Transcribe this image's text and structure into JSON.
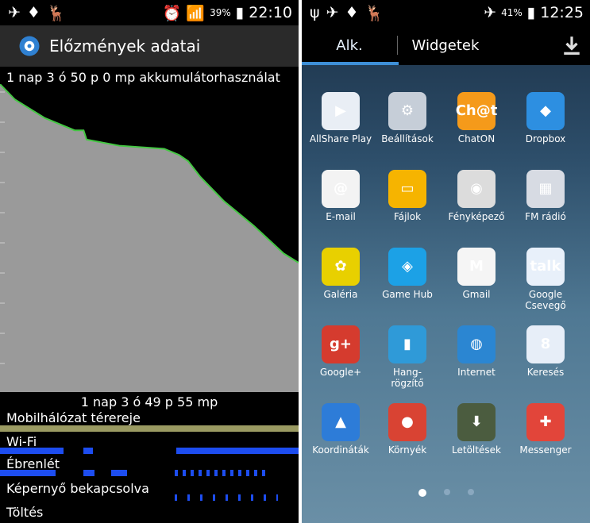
{
  "left": {
    "status": {
      "battery_pct": "39%",
      "time": "22:10"
    },
    "title": "Előzmények adatai",
    "battery_line": "1 nap 3 ó 50 p 0 mp akkumulátorhasználat",
    "duration": "1 nap 3 ó 49 p 55 mp",
    "rows": [
      {
        "label": "Mobilhálózat térereje"
      },
      {
        "label": "Wi-Fi"
      },
      {
        "label": "Ébrenlét"
      },
      {
        "label": "Képernyő bekapcsolva"
      },
      {
        "label": "Töltés"
      }
    ],
    "chart_data": {
      "type": "area",
      "x": [
        0,
        0.05,
        0.15,
        0.25,
        0.28,
        0.29,
        0.4,
        0.55,
        0.6,
        0.63,
        0.67,
        0.75,
        0.85,
        0.95,
        1.0
      ],
      "values": [
        100,
        95,
        89,
        85,
        85,
        82,
        80,
        79,
        77,
        75,
        70,
        62,
        54,
        45,
        42
      ],
      "ylim": [
        0,
        100
      ]
    }
  },
  "right": {
    "status": {
      "battery_pct": "41%",
      "time": "12:25"
    },
    "tabs": [
      {
        "label": "Alk."
      },
      {
        "label": "Widgetek"
      }
    ],
    "apps": [
      {
        "label": "AllShare Play",
        "icon": "allshare-icon",
        "color": "#e9eef5",
        "glyph": "▶"
      },
      {
        "label": "Beállítások",
        "icon": "settings-icon",
        "color": "#c6ced8",
        "glyph": "⚙"
      },
      {
        "label": "ChatON",
        "icon": "chaton-icon",
        "color": "#f59a1a",
        "glyph": "Ch@t"
      },
      {
        "label": "Dropbox",
        "icon": "dropbox-icon",
        "color": "#2d8fe1",
        "glyph": "◆"
      },
      {
        "label": "E-mail",
        "icon": "email-icon",
        "color": "#f3f3f3",
        "glyph": "@"
      },
      {
        "label": "Fájlok",
        "icon": "files-icon",
        "color": "#f6b400",
        "glyph": "▭"
      },
      {
        "label": "Fényképező",
        "icon": "camera-icon",
        "color": "#dcdcdc",
        "glyph": "◉"
      },
      {
        "label": "FM rádió",
        "icon": "fm-radio-icon",
        "color": "#d7dbe3",
        "glyph": "▦"
      },
      {
        "label": "Galéria",
        "icon": "gallery-icon",
        "color": "#e8d000",
        "glyph": "✿"
      },
      {
        "label": "Game Hub",
        "icon": "gamehub-icon",
        "color": "#1ca1e6",
        "glyph": "◈"
      },
      {
        "label": "Gmail",
        "icon": "gmail-icon",
        "color": "#f5f5f5",
        "glyph": "M"
      },
      {
        "label": "Google Csevegő",
        "icon": "talk-icon",
        "color": "#e8f0fa",
        "glyph": "talk"
      },
      {
        "label": "Google+",
        "icon": "google-plus-icon",
        "color": "#d53b2e",
        "glyph": "g+"
      },
      {
        "label": "Hang-\nrögzítő",
        "icon": "voice-recorder-icon",
        "color": "#2f9ad8",
        "glyph": "▮"
      },
      {
        "label": "Internet",
        "icon": "internet-icon",
        "color": "#2b86d2",
        "glyph": "◍"
      },
      {
        "label": "Keresés",
        "icon": "search-icon",
        "color": "#e7eef8",
        "glyph": "8"
      },
      {
        "label": "Koordináták",
        "icon": "latitude-icon",
        "color": "#2d7cd8",
        "glyph": "▲"
      },
      {
        "label": "Környék",
        "icon": "local-icon",
        "color": "#d94333",
        "glyph": "●"
      },
      {
        "label": "Letöltések",
        "icon": "downloads-icon",
        "color": "#4b5c3f",
        "glyph": "⬇"
      },
      {
        "label": "Messenger",
        "icon": "messenger-icon",
        "color": "#e2453a",
        "glyph": "✚"
      }
    ],
    "dots": [
      "dot-1",
      "dot-2",
      "dot-3"
    ]
  }
}
